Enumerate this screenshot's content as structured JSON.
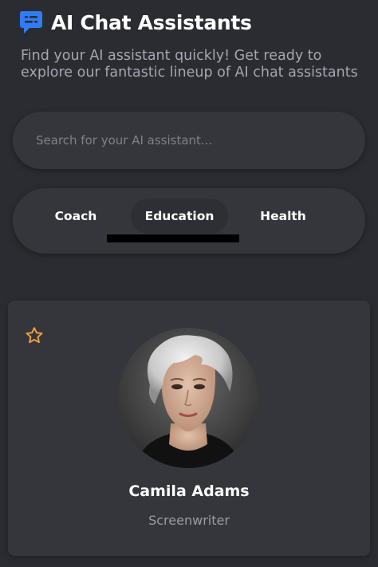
{
  "header": {
    "title": "AI Chat Assistants",
    "logo_icon": "chat-bubble-icon",
    "logo_color": "#2f7cf6"
  },
  "intro": {
    "subtitle": "Find your AI assistant quickly! Get ready to explore our fantastic lineup of AI chat assistants"
  },
  "search": {
    "placeholder": "Search for your AI assistant...",
    "value": ""
  },
  "tabs": {
    "items": [
      {
        "label": "Coach"
      },
      {
        "label": "Education"
      },
      {
        "label": "Health"
      }
    ],
    "active": "Education"
  },
  "card": {
    "favorite_icon": "star-outline-icon",
    "favorite_color": "#f2a33a",
    "name": "Camila Adams",
    "role": "Screenwriter"
  },
  "colors": {
    "background": "#2b2c31",
    "surface": "#35363c",
    "text_primary": "#ffffff",
    "text_secondary": "#a3a6b3"
  }
}
